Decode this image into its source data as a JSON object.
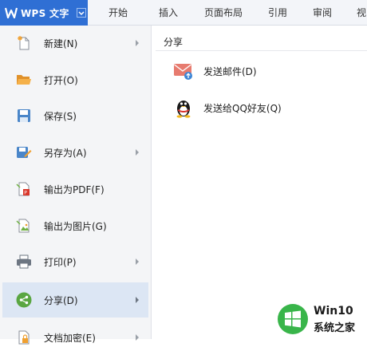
{
  "app": {
    "title": "WPS 文字",
    "accent_color": "#2f6fd4"
  },
  "ribbon_tabs": [
    "开始",
    "插入",
    "页面布局",
    "引用",
    "审阅",
    "视"
  ],
  "menu": {
    "items": [
      {
        "label": "新建(N)",
        "icon": "new-document-icon",
        "has_submenu": true
      },
      {
        "label": "打开(O)",
        "icon": "open-folder-icon",
        "has_submenu": false
      },
      {
        "label": "保存(S)",
        "icon": "save-icon",
        "has_submenu": false
      },
      {
        "label": "另存为(A)",
        "icon": "save-as-icon",
        "has_submenu": true
      },
      {
        "label": "输出为PDF(F)",
        "icon": "export-pdf-icon",
        "has_submenu": false
      },
      {
        "label": "输出为图片(G)",
        "icon": "export-image-icon",
        "has_submenu": false
      },
      {
        "label": "打印(P)",
        "icon": "printer-icon",
        "has_submenu": true
      },
      {
        "label": "分享(D)",
        "icon": "share-icon",
        "has_submenu": true,
        "active": true
      },
      {
        "label": "文档加密(E)",
        "icon": "encrypt-icon",
        "has_submenu": true
      }
    ]
  },
  "share_panel": {
    "title": "分享",
    "items": [
      {
        "label": "发送邮件(D)",
        "icon": "email-icon"
      },
      {
        "label": "发送给QQ好友(Q)",
        "icon": "qq-penguin-icon"
      }
    ]
  },
  "watermark": {
    "line1": "Win10",
    "line2": "系统之家"
  }
}
